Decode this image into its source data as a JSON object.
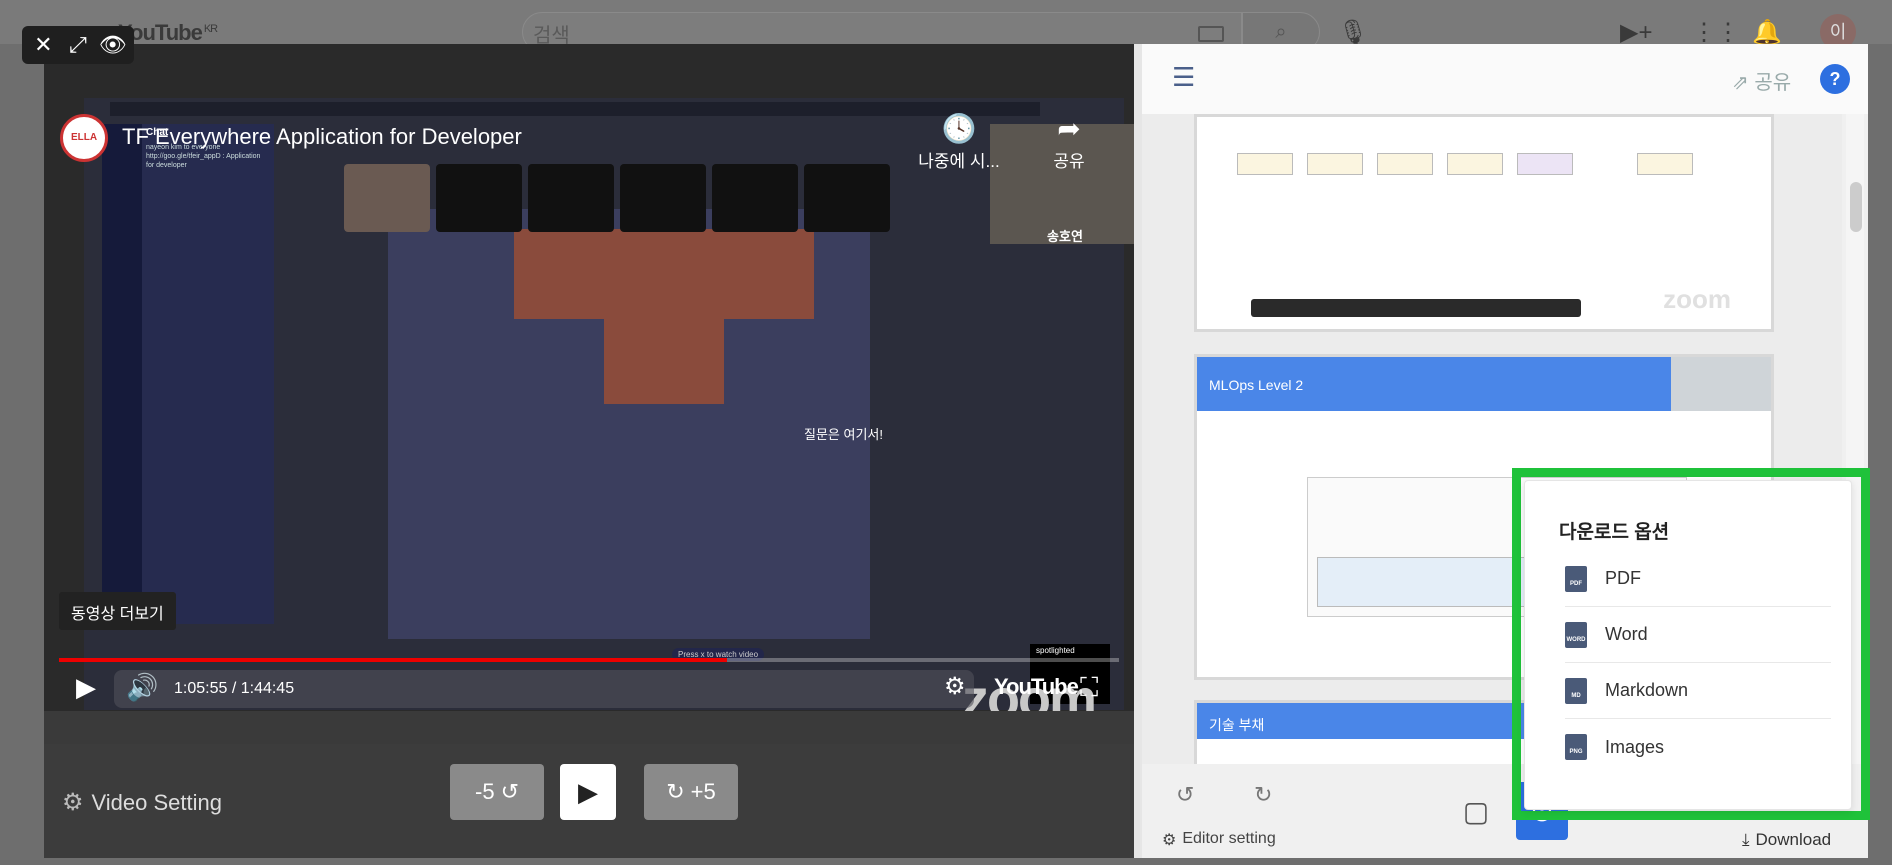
{
  "youtube": {
    "logo": "YouTube",
    "region": "KR",
    "search_placeholder": "검색",
    "avatar_letter": "이"
  },
  "overlay": {
    "close": "✕",
    "expand": "⤢",
    "view": "👁"
  },
  "video": {
    "channel": "ELLA",
    "title": "TF Everywhere Application for Developer",
    "watch_later": "나중에 시...",
    "share": "공유",
    "more_videos": "동영상 더보기",
    "time": "1:05:55 / 1:44:45",
    "progress": 0.63,
    "youtube_word": "YouTube",
    "speaker_name": "송호연",
    "chat_title": "Chat",
    "chat_text": "nayeon kim to everyone  http://goo.gle/tfeir_appD : Application for developer",
    "map_label": "질문은 여기서!",
    "watch_hint": "Press x to watch video",
    "spotlight": "spotlighted",
    "zoom": "zoom"
  },
  "controls": {
    "video_setting": "Video Setting",
    "back": "-5",
    "forward": "+5"
  },
  "editor": {
    "share": "공유",
    "help": "?",
    "slide2_title": "MLOps Level 2",
    "slide3_title": "기술 부채",
    "editor_setting": "Editor setting",
    "download": "Download",
    "zoom": "zoom"
  },
  "download_popup": {
    "title": "다운로드 옵션",
    "options": [
      {
        "label": "PDF",
        "tag": "PDF"
      },
      {
        "label": "Word",
        "tag": "WORD"
      },
      {
        "label": "Markdown",
        "tag": "MD"
      },
      {
        "label": "Images",
        "tag": "PNG"
      }
    ]
  },
  "colors": {
    "highlight": "#1fc23a",
    "accent": "#2d6fe0",
    "progress": "#ee0000",
    "slide_header": "#4a86e8"
  }
}
